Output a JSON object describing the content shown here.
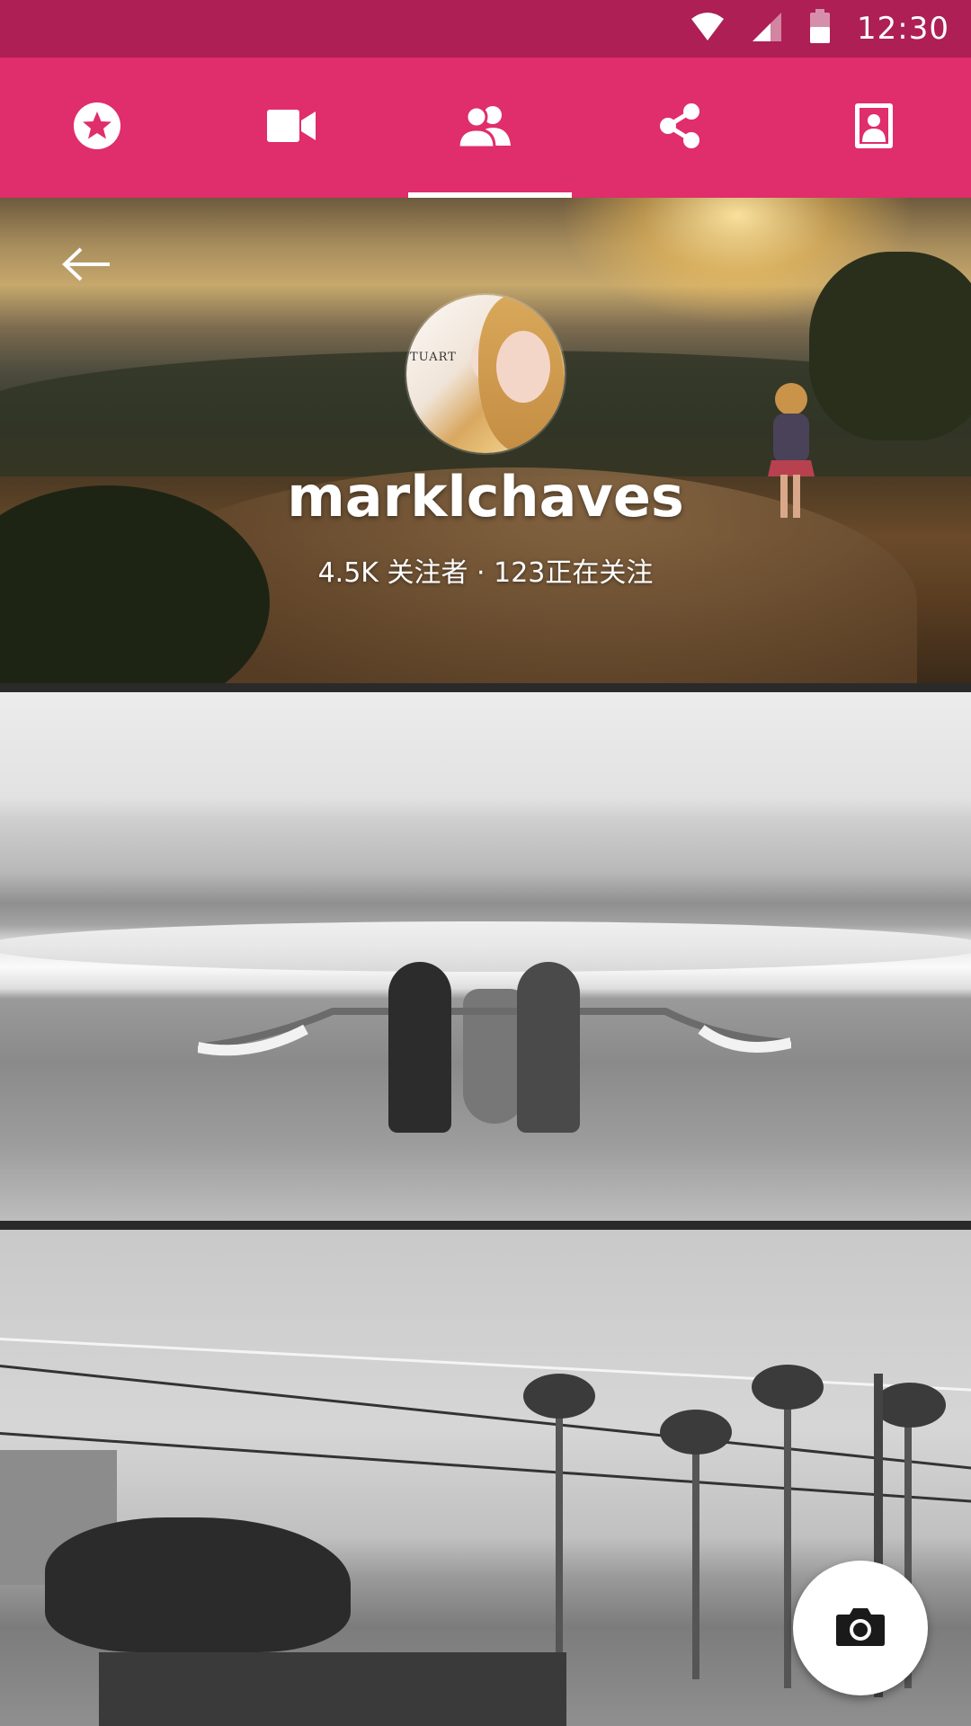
{
  "status_bar": {
    "time": "12:30",
    "icons": [
      "wifi-icon",
      "signal-icon",
      "battery-icon"
    ]
  },
  "toolbar": {
    "tabs": [
      {
        "name": "favorites",
        "icon": "star-icon"
      },
      {
        "name": "videos",
        "icon": "video-camera-icon"
      },
      {
        "name": "people",
        "icon": "people-icon"
      },
      {
        "name": "share",
        "icon": "share-icon"
      },
      {
        "name": "contact",
        "icon": "contact-card-icon"
      }
    ],
    "selected_index": 2,
    "background": "#e02d6b",
    "status_background": "#ad1f55"
  },
  "profile": {
    "avatar_text": "TUART",
    "username": "marklchaves",
    "follow_stats": "4.5K 关注者 · 123正在关注"
  },
  "feed": {
    "photos": [
      "sunset-landscape-photo",
      "beach-fishermen-photo",
      "street-palms-photo"
    ]
  },
  "fab": {
    "icon": "camera-icon",
    "color": "#ffffff"
  }
}
